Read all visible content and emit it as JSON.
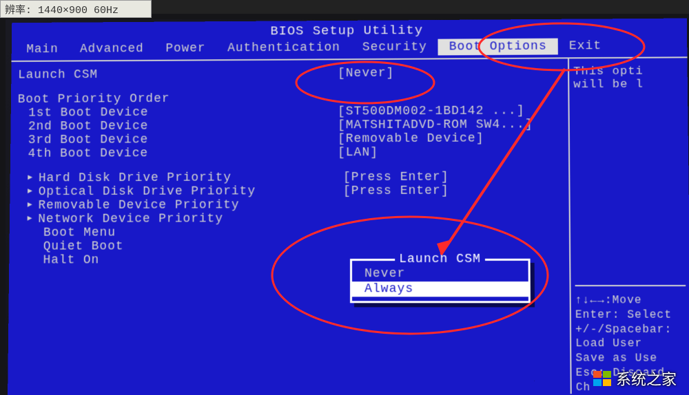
{
  "monitorLabel": "辨率: 1440×900 60Hz",
  "title": "BIOS Setup Utility",
  "tabs": [
    "Main",
    "Advanced",
    "Power",
    "Authentication",
    "Security",
    "Boot Options",
    "Exit"
  ],
  "activeTab": "Boot Options",
  "launchCSM": {
    "label": "Launch CSM",
    "value": "[Never]"
  },
  "bootPriorityHeader": "Boot Priority Order",
  "bootDevices": [
    {
      "label": "1st Boot Device",
      "value": "[ST500DM002-1BD142  ...]"
    },
    {
      "label": "2nd Boot Device",
      "value": "[MATSHITADVD-ROM SW4...]"
    },
    {
      "label": "3rd Boot Device",
      "value": "[Removable Device]"
    },
    {
      "label": "4th Boot Device",
      "value": "[LAN]"
    }
  ],
  "priorityMenus": [
    {
      "label": "Hard Disk Drive Priority",
      "value": "[Press Enter]"
    },
    {
      "label": "Optical Disk Drive Priority",
      "value": "[Press Enter]"
    },
    {
      "label": "Removable Device Priority",
      "value": ""
    },
    {
      "label": "Network Device Priority",
      "value": ""
    }
  ],
  "simpleItems": [
    "Boot Menu",
    "Quiet Boot",
    "Halt On"
  ],
  "popup": {
    "title": "Launch CSM",
    "options": [
      "Never",
      "Always"
    ],
    "selected": "Always"
  },
  "sideHelp": {
    "line1": "This opti",
    "line2": "will be l"
  },
  "legend": {
    "l1": "↑↓←→:Move",
    "l2": "Enter: Select",
    "l3": "+/-/Spacebar:",
    "l4": "   Load User",
    "l5": "   Save as Use",
    "l6": "Esc: Discard Ch"
  },
  "watermark": "系统之家"
}
